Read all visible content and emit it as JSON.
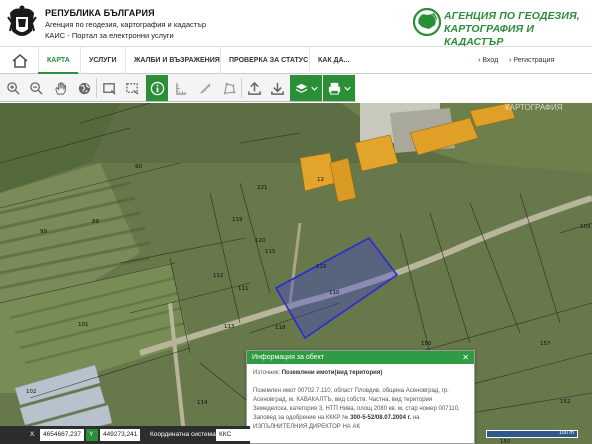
{
  "header": {
    "gov_title": "РЕПУБЛИКА БЪЛГАРИЯ",
    "gov_subtitle": "Агенция по геодезия, картография и кадастър",
    "portal_name": "КАИС - Портал за електронни услуги",
    "agency_line1": "АГЕНЦИЯ ПО ГЕОДЕЗИЯ,",
    "agency_line2": "КАРТОГРАФИЯ И КАДАСТЪР"
  },
  "nav": {
    "items": [
      {
        "label": "КАРТА",
        "active": true
      },
      {
        "label": "УСЛУГИ"
      },
      {
        "label": "ЖАЛБИ И ВЪЗРАЖЕНИЯ"
      },
      {
        "label": "ПРОВЕРКА ЗА СТАТУС"
      },
      {
        "label": "КАК ДА..."
      }
    ],
    "login": "Вход",
    "register": "Регистрация"
  },
  "toolbar": {
    "icons": [
      "zoom-in-icon",
      "zoom-out-icon",
      "pan-hand-icon",
      "globe-icon",
      "select-rectangle-icon",
      "select-area-icon",
      "info-icon",
      "measure-icon",
      "ruler-icon",
      "polygon-area-icon",
      "upload-icon",
      "download-icon",
      "layers-icon",
      "print-icon"
    ]
  },
  "map": {
    "watermark": "КАРТОГРАФИЯ",
    "parcel_numbers": [
      "90",
      "89",
      "119",
      "120",
      "221",
      "12",
      "99",
      "110",
      "111",
      "112",
      "113",
      "114",
      "115",
      "116",
      "118",
      "150",
      "101",
      "102",
      "103",
      "157",
      "150",
      "152"
    ]
  },
  "popup": {
    "title": "Информация за обект",
    "source_label": "Източник:",
    "source_value": "Поземлени имоти(вид територия)",
    "description": "Поземлен имот 00702.7.110, област Пловдив, община Асеновград, гр. Асеновград, м. КАВАКАЛТЪ, вид собств. Частна, вид територия Земеделска, категория 3, НТП Нива, площ 2080 кв. м, стар номер 007110, Заповед за одобрение на КККР №",
    "order_number": "300-5-52/08.07.2004 г.",
    "order_suffix": "на",
    "director": "ИЗПЪЛНИТЕЛНИЯ ДИРЕКТОР НА АК"
  },
  "coords": {
    "x_label": "X",
    "x_value": "4654667,237",
    "y_label": "Y",
    "y_value": "449273,241",
    "system_label": "Координатна система",
    "system_value": "ККС 2005"
  },
  "scale": {
    "label": "100 m"
  },
  "colors": {
    "accent": "#2a8f36",
    "popup_header": "#2f9b44",
    "parcel_highlight": "#2a2ad6"
  }
}
